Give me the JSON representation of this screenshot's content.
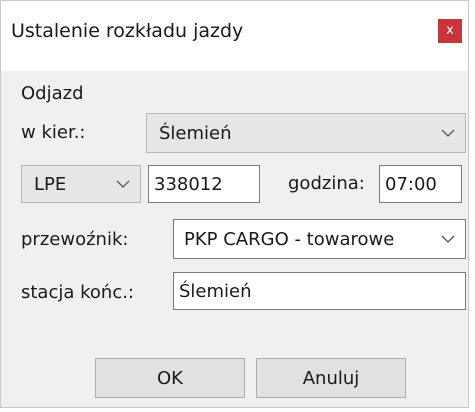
{
  "window": {
    "title": "Ustalenie rozkładu jazdy",
    "close_label": "x"
  },
  "section": {
    "title": "Odjazd"
  },
  "direction": {
    "label": "w kier.:",
    "value": "Ślemień"
  },
  "line_code": {
    "value": "LPE"
  },
  "train_number": {
    "value": "338012"
  },
  "time": {
    "label": "godzina:",
    "value": "07:00"
  },
  "carrier": {
    "label": "przewoźnik:",
    "value": "PKP CARGO - towarowe"
  },
  "final_station": {
    "label": "stacja końc.:",
    "value": "Ślemień"
  },
  "buttons": {
    "ok": "OK",
    "cancel": "Anuluj"
  },
  "colors": {
    "close_bg": "#c9343a",
    "dialog_bg": "#f0f0f0"
  }
}
